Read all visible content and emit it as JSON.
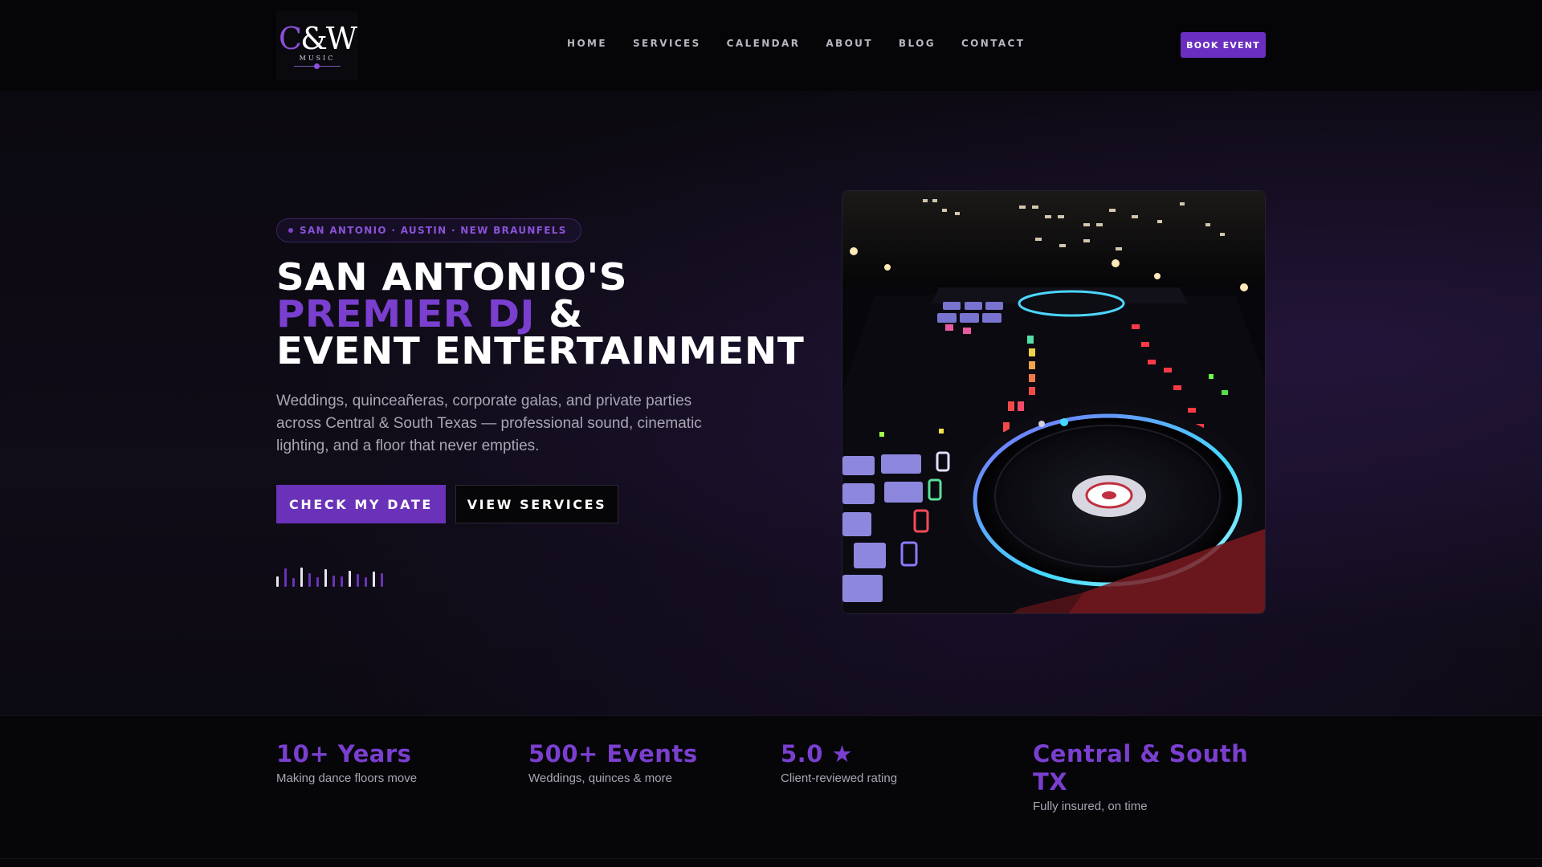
{
  "brand": {
    "logo_text": "C&W",
    "logo_sub": "MUSIC"
  },
  "nav": {
    "links": [
      "HOME",
      "SERVICES",
      "CALENDAR",
      "ABOUT",
      "BLOG",
      "CONTACT"
    ],
    "cta": "BOOK EVENT"
  },
  "hero": {
    "chip": "SAN ANTONIO · AUSTIN · NEW BRAUNFELS",
    "headline_line1": "SAN ANTONIO'S",
    "headline_accent": "PREMIER DJ",
    "headline_amp": " &",
    "headline_line3": "EVENT ENTERTAINMENT",
    "subtext": "Weddings, quinceañeras, corporate galas, and private parties across Central & South Texas — professional sound, cinematic lighting, and a floor that never empties.",
    "primary_button": "CHECK MY DATE",
    "secondary_button": "VIEW SERVICES",
    "equalizer_levels": [
      0.55,
      0.95,
      0.45,
      1.0,
      0.7,
      0.5,
      0.9,
      0.6,
      0.55,
      0.85,
      0.65,
      0.5,
      0.8,
      0.7
    ],
    "image_icon": "dj-controller-photo"
  },
  "stats": [
    {
      "value": "10+ Years",
      "label": "Making dance floors move"
    },
    {
      "value": "500+ Events",
      "label": "Weddings, quinces & more"
    },
    {
      "value": "5.0 ★",
      "label": "Client-reviewed rating"
    },
    {
      "value": "Central & South TX",
      "label": "Fully insured, on time"
    }
  ],
  "colors": {
    "accent": "#6a32b8",
    "accent_text": "#7a3fcf",
    "background": "#08070c"
  }
}
